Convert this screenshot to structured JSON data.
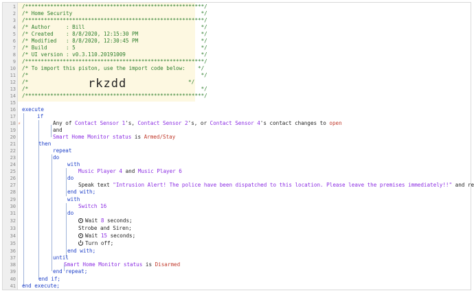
{
  "lines": {
    "1": "/*********************************************************/",
    "2": "/* Home Security                                         */",
    "3": "/*********************************************************/",
    "4": "/* Author     : Bill                                     */",
    "5": "/* Created    : 8/8/2020, 12:15:30 PM                    */",
    "6": "/* Modified   : 8/8/2020, 12:30:45 PM                    */",
    "7": "/* Build      : 5                                        */",
    "8": "/* UI version : v0.3.110.20191009                        */",
    "9": "/*********************************************************/",
    "10": "/* To import this piston, use the import code below:    */",
    "11": "/*                                                       */",
    "12a": "/*",
    "12b": "*/",
    "13": "/*                                                       */",
    "14": "/*********************************************************/",
    "import_code": "rkzdd"
  },
  "code": {
    "execute": "execute",
    "if": "if",
    "any_of": "Any of ",
    "cs1": "Contact Sensor 1",
    "s1": "'s, ",
    "cs2": "Contact Sensor 2",
    "s2": "'s, or ",
    "cs4": "Contact Sensor 4",
    "s4": "'s contact changes to ",
    "open": "open",
    "and": "and",
    "shm": "Smart Home Monitor status",
    "is": " is ",
    "armed": "Armed/Stay",
    "then": "then",
    "repeat": "repeat",
    "do": "do",
    "with": "with",
    "mp4": "Music Player 4",
    "and2": " and ",
    "mp6": "Music Player 6",
    "speak_pre": "Speak text ",
    "speak_str": "\"Intrusion Alert! The police have been dispatched to this location. Please leave the premises immediately!!\"",
    "speak_post": " and restore;",
    "end_with": "end with;",
    "sw16": "Switch 16",
    "wait": "Wait ",
    "eight": "8",
    "seconds": " seconds;",
    "strobe": "Strobe and Siren;",
    "fifteen": "15",
    "turn_off": "Turn off;",
    "until": "until",
    "disarmed": "Disarmed",
    "end_repeat": "end repeat;",
    "end_if": "end if;",
    "end_execute": "end execute;"
  },
  "line_numbers": [
    "1",
    "2",
    "3",
    "4",
    "5",
    "6",
    "7",
    "8",
    "9",
    "10",
    "11",
    "12",
    "13",
    "14",
    "15",
    "16",
    "17",
    "18",
    "19",
    "20",
    "21",
    "22",
    "23",
    "24",
    "25",
    "26",
    "27",
    "28",
    "29",
    "30",
    "31",
    "32",
    "33",
    "34",
    "35",
    "36",
    "37",
    "38",
    "39",
    "40",
    "41"
  ]
}
